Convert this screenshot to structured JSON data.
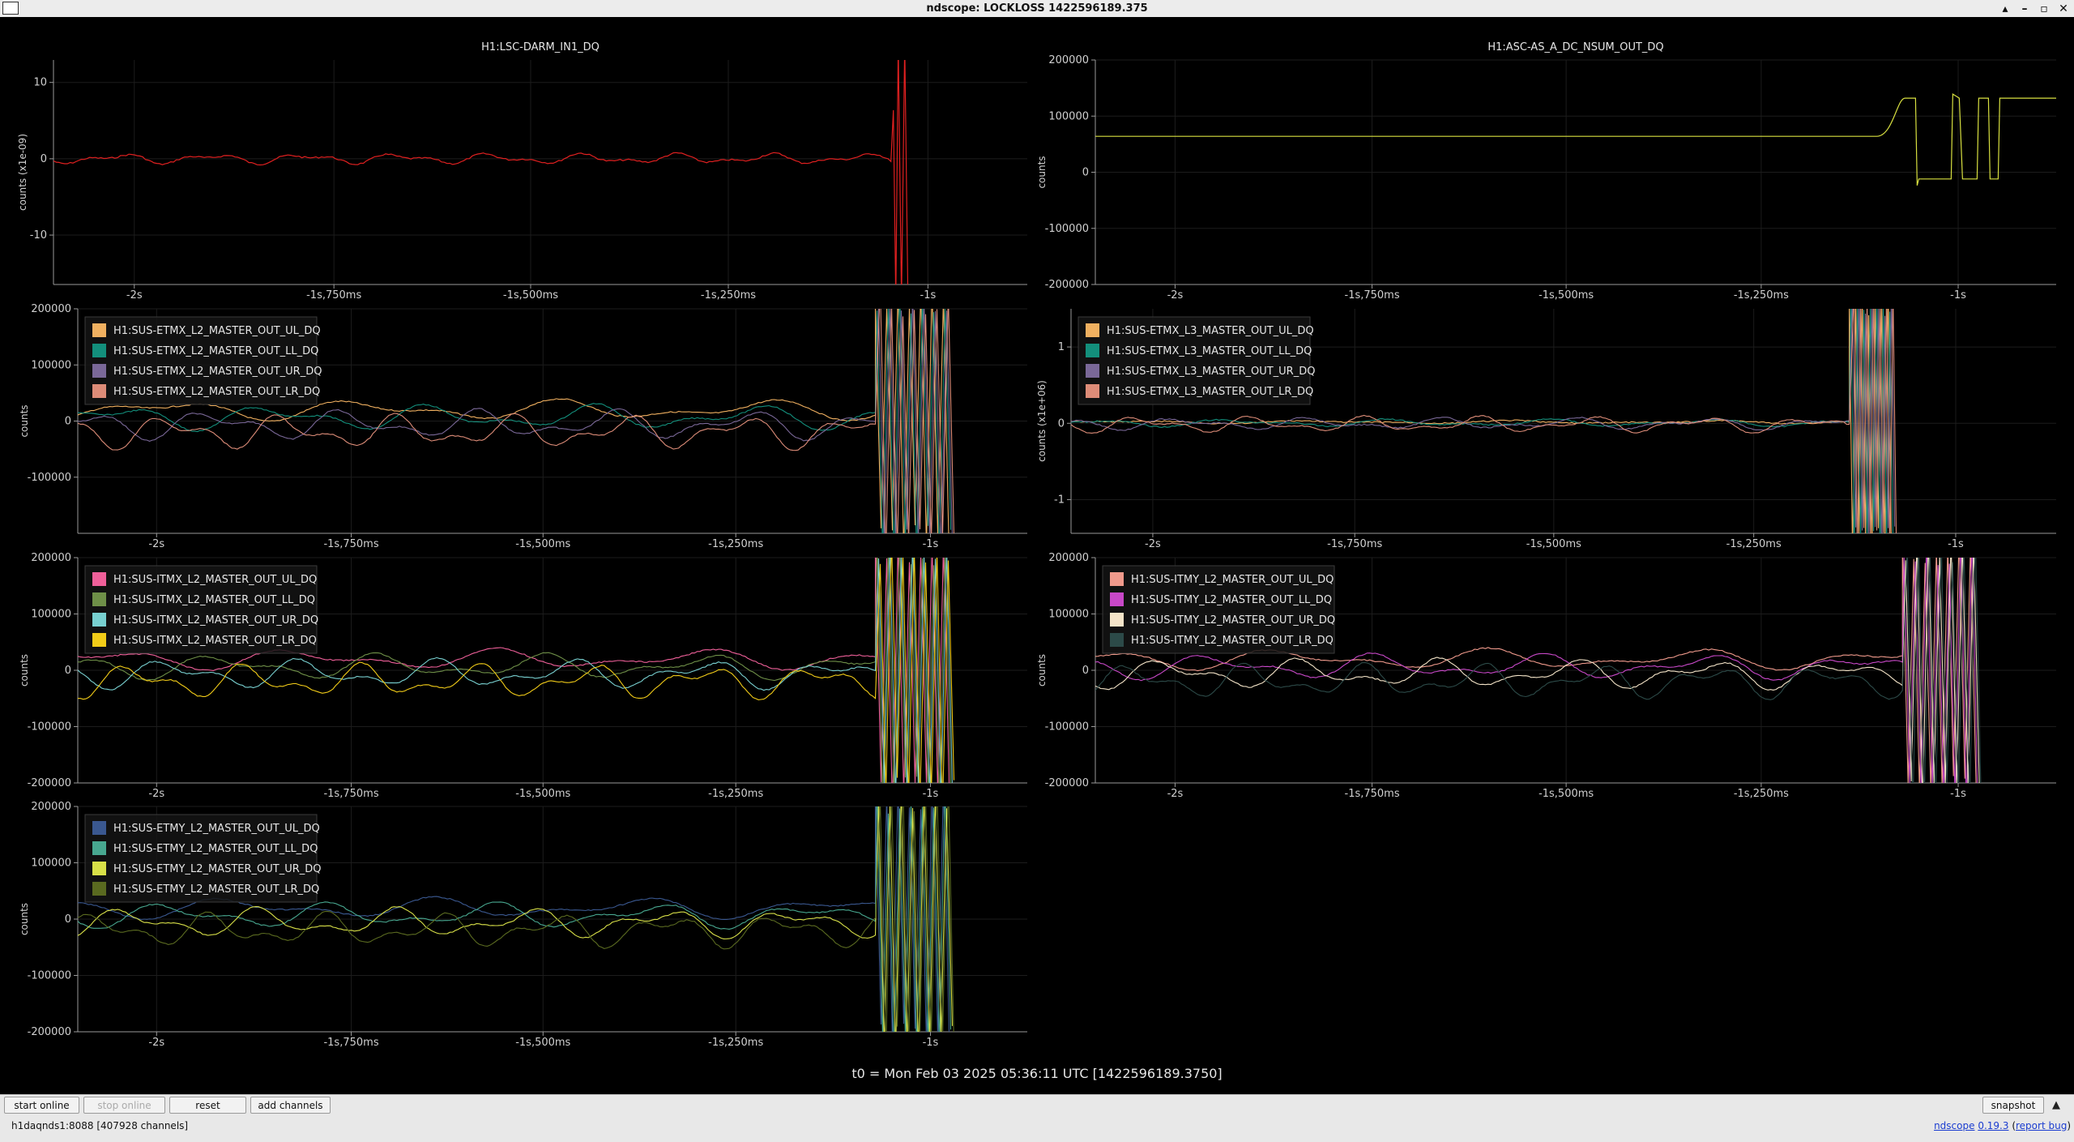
{
  "window": {
    "title": "ndscope: LOCKLOSS 1422596189.375"
  },
  "x_ticks": [
    "-2s",
    "-1s,750ms",
    "-1s,500ms",
    "-1s,250ms",
    "-1s"
  ],
  "colors": {
    "background": "#000000",
    "grid": "#1c1c1c",
    "axis": "#9a9a9a"
  },
  "plots": [
    {
      "title": "H1:LSC-DARM_IN1_DQ",
      "ylabel": "counts (x1e-09)",
      "yticks": [
        "10",
        "0",
        "-10"
      ],
      "legend": []
    },
    {
      "title": "H1:ASC-AS_A_DC_NSUM_OUT_DQ",
      "ylabel": "counts",
      "yticks": [
        "200000",
        "100000",
        "0",
        "-100000",
        "-200000"
      ],
      "legend": []
    },
    {
      "title": "",
      "ylabel": "counts",
      "yticks": [
        "200000",
        "100000",
        "0",
        "-100000"
      ],
      "legend": [
        {
          "name": "H1:SUS-ETMX_L2_MASTER_OUT_UL_DQ",
          "color": "#f0b060"
        },
        {
          "name": "H1:SUS-ETMX_L2_MASTER_OUT_LL_DQ",
          "color": "#138f7c"
        },
        {
          "name": "H1:SUS-ETMX_L2_MASTER_OUT_UR_DQ",
          "color": "#7a6898"
        },
        {
          "name": "H1:SUS-ETMX_L2_MASTER_OUT_LR_DQ",
          "color": "#dd8c78"
        }
      ]
    },
    {
      "title": "",
      "ylabel": "counts (x1e+06)",
      "yticks": [
        "1",
        "0",
        "-1"
      ],
      "legend": [
        {
          "name": "H1:SUS-ETMX_L3_MASTER_OUT_UL_DQ",
          "color": "#f0b060"
        },
        {
          "name": "H1:SUS-ETMX_L3_MASTER_OUT_LL_DQ",
          "color": "#138f7c"
        },
        {
          "name": "H1:SUS-ETMX_L3_MASTER_OUT_UR_DQ",
          "color": "#7a6898"
        },
        {
          "name": "H1:SUS-ETMX_L3_MASTER_OUT_LR_DQ",
          "color": "#dd8c78"
        }
      ]
    },
    {
      "title": "",
      "ylabel": "counts",
      "yticks": [
        "200000",
        "100000",
        "0",
        "-100000",
        "-200000"
      ],
      "legend": [
        {
          "name": "H1:SUS-ITMX_L2_MASTER_OUT_UL_DQ",
          "color": "#f0609a"
        },
        {
          "name": "H1:SUS-ITMX_L2_MASTER_OUT_LL_DQ",
          "color": "#6f9048"
        },
        {
          "name": "H1:SUS-ITMX_L2_MASTER_OUT_UR_DQ",
          "color": "#78d0d0"
        },
        {
          "name": "H1:SUS-ITMX_L2_MASTER_OUT_LR_DQ",
          "color": "#f2cc18"
        }
      ]
    },
    {
      "title": "",
      "ylabel": "counts",
      "yticks": [
        "200000",
        "100000",
        "0",
        "-100000",
        "-200000"
      ],
      "legend": [
        {
          "name": "H1:SUS-ITMY_L2_MASTER_OUT_UL_DQ",
          "color": "#f09a8c"
        },
        {
          "name": "H1:SUS-ITMY_L2_MASTER_OUT_LL_DQ",
          "color": "#c848c8"
        },
        {
          "name": "H1:SUS-ITMY_L2_MASTER_OUT_UR_DQ",
          "color": "#f4e4c8"
        },
        {
          "name": "H1:SUS-ITMY_L2_MASTER_OUT_LR_DQ",
          "color": "#2c4a48"
        }
      ]
    },
    {
      "title": "",
      "ylabel": "counts",
      "yticks": [
        "200000",
        "100000",
        "0",
        "-100000",
        "-200000"
      ],
      "legend": [
        {
          "name": "H1:SUS-ETMY_L2_MASTER_OUT_UL_DQ",
          "color": "#3a5890"
        },
        {
          "name": "H1:SUS-ETMY_L2_MASTER_OUT_LL_DQ",
          "color": "#48a890"
        },
        {
          "name": "H1:SUS-ETMY_L2_MASTER_OUT_UR_DQ",
          "color": "#d8e048"
        },
        {
          "name": "H1:SUS-ETMY_L2_MASTER_OUT_LR_DQ",
          "color": "#5a6a20"
        }
      ]
    }
  ],
  "t0_label": "t0 = Mon Feb 03 2025 05:36:11 UTC [1422596189.3750]",
  "buttons": {
    "start_online": "start online",
    "stop_online": "stop online",
    "reset": "reset",
    "add_channels": "add channels",
    "snapshot": "snapshot"
  },
  "status": {
    "server": "h1daqnds1:8088",
    "channels": "[407928 channels]",
    "app_name": "ndscope",
    "version": "0.19.3",
    "report_bug": "report bug"
  }
}
